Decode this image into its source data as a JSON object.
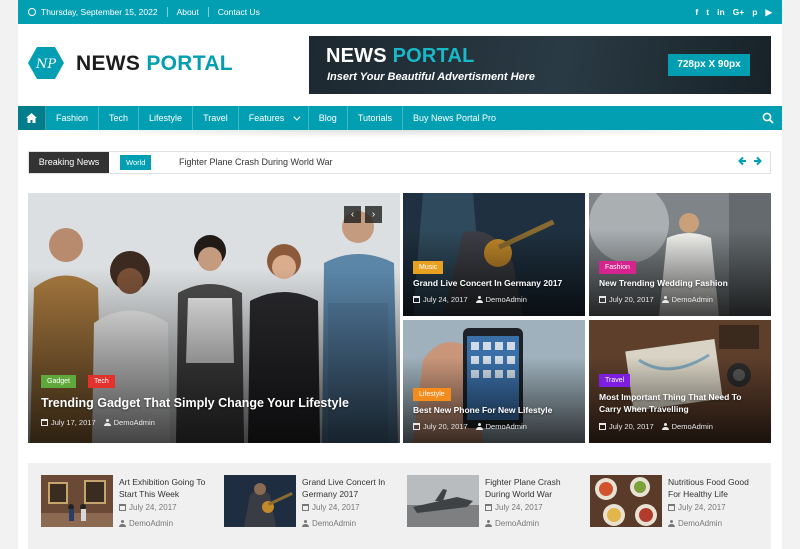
{
  "topbar": {
    "date": "Thursday, September 15, 2022",
    "links": [
      "About",
      "Contact Us"
    ],
    "social_icons": [
      "facebook-icon",
      "twitter-icon",
      "linkedin-icon",
      "google-plus-icon",
      "pinterest-icon",
      "youtube-icon"
    ],
    "social_glyphs": [
      "f",
      "t",
      "in",
      "G+",
      "p",
      "▶"
    ]
  },
  "logo": {
    "mark": "NP",
    "name_a": "NEWS",
    "name_b": "PORTAL"
  },
  "ad": {
    "title_a": "NEWS",
    "title_b": "PORTAL",
    "subtitle": "Insert Your Beautiful Advertisment Here",
    "size": "728px X 90px"
  },
  "nav": {
    "items": [
      "Fashion",
      "Tech",
      "Lifestyle",
      "Travel",
      "Features",
      "Blog",
      "Tutorials",
      "Buy News Portal Pro"
    ]
  },
  "breaking": {
    "label": "Breaking News",
    "category": "World",
    "headline": "Fighter Plane Crash During World War"
  },
  "hero": {
    "main": {
      "badges": [
        "Gadget",
        "Tech"
      ],
      "title": "Trending Gadget That Simply Change Your Lifestyle",
      "date": "July 17, 2017",
      "author": "DemoAdmin"
    },
    "tiles": [
      {
        "badge": "Music",
        "title": "Grand Live Concert In Germany 2017",
        "date": "July 24, 2017",
        "author": "DemoAdmin"
      },
      {
        "badge": "Fashion",
        "title": "New Trending Wedding Fashion",
        "date": "July 20, 2017",
        "author": "DemoAdmin"
      },
      {
        "badge": "Lifestyle",
        "title": "Best New Phone For New Lifestyle",
        "date": "July 20, 2017",
        "author": "DemoAdmin"
      },
      {
        "badge": "Travel",
        "title": "Most Important Thing That Need To Carry When Travelling",
        "date": "July 20, 2017",
        "author": "DemoAdmin"
      }
    ]
  },
  "strip": {
    "posts": [
      {
        "title": "Art Exhibition Going To Start This Week",
        "date": "July 24, 2017",
        "author": "DemoAdmin"
      },
      {
        "title": "Grand Live Concert In Germany 2017",
        "date": "July 24, 2017",
        "author": "DemoAdmin"
      },
      {
        "title": "Fighter Plane Crash During World War",
        "date": "July 24, 2017",
        "author": "DemoAdmin"
      },
      {
        "title": "Nutritious Food Good For Healthy Life",
        "date": "July 24, 2017",
        "author": "DemoAdmin"
      }
    ]
  },
  "colors": {
    "accent": "#029fb2",
    "music": "#e8a021",
    "fashion": "#d6248e",
    "lifestyle": "#f28c1c",
    "travel": "#7d1ee0",
    "gadget": "#5fa83b",
    "tech": "#e2322b"
  }
}
